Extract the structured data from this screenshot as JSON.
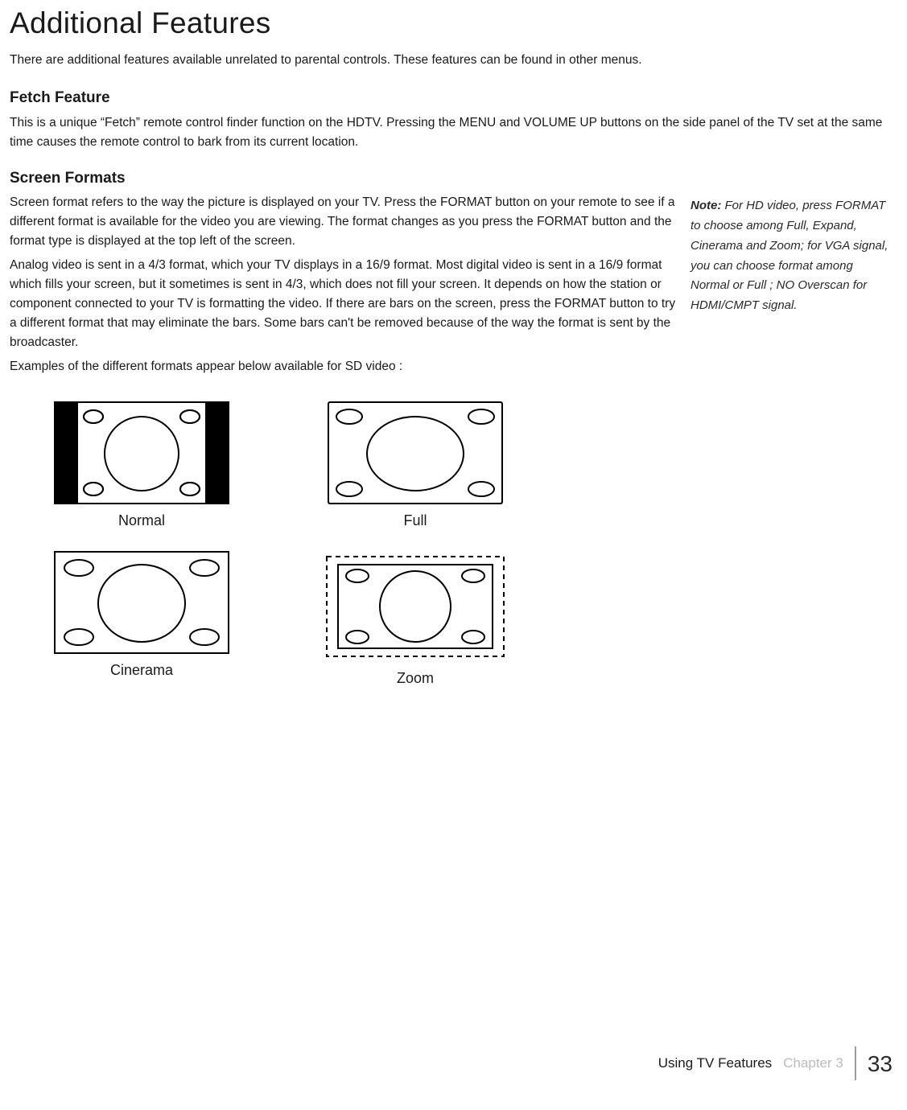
{
  "page_title": "Additional Features",
  "intro": "There are additional features available unrelated to parental controls. These features can be found in other menus.",
  "fetch": {
    "heading": "Fetch Feature",
    "body": "This is a unique “Fetch” remote control finder function on the HDTV. Pressing the MENU and VOLUME UP buttons on the side panel of the TV set at the same time causes the remote control to bark from its current location."
  },
  "formats": {
    "heading": "Screen Formats",
    "p1": "Screen format refers to the way the picture is displayed on your TV. Press the FORMAT button on your remote to see if a different format is available for the video you are viewing. The format changes as you press the FORMAT button and the format type is displayed at the top left of the screen.",
    "p2": "Analog video is sent in a 4/3 format, which your TV displays in a 16/9 format. Most digital video is sent in a 16/9 format which fills your screen, but it sometimes is sent in 4/3, which does not fill your screen. It depends on how the station or component connected to your TV is formatting the video. If there are bars on the screen, press the FORMAT button to try a different format that may eliminate the bars. Some bars can't be removed because of the way the format is sent by the broadcaster.",
    "p3": "Examples of the different formats appear below available for SD video :",
    "note_label": "Note:",
    "note": "For HD video, press FORMAT to choose among Full, Expand, Cinerama and Zoom; for VGA signal, you can choose format among Normal or Full ; NO Overscan for HDMI/CMPT signal."
  },
  "diagrams": {
    "normal": "Normal",
    "full": "Full",
    "cinerama": "Cinerama",
    "zoom": "Zoom"
  },
  "footer": {
    "section": "Using TV Features",
    "chapter": "Chapter 3",
    "page": "33"
  }
}
